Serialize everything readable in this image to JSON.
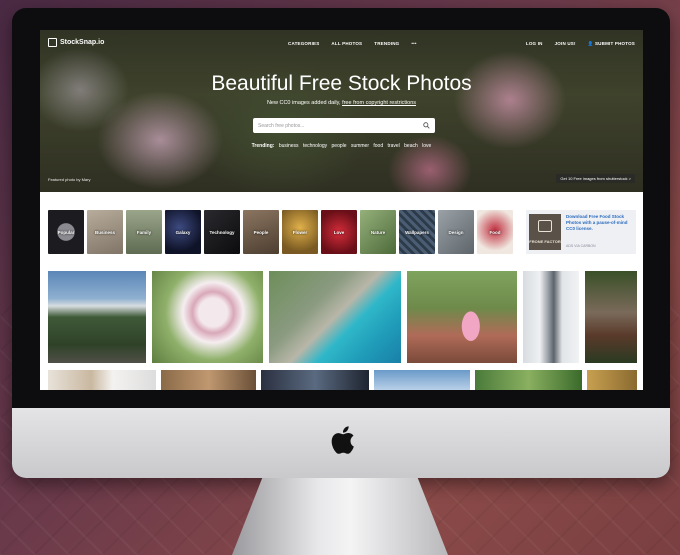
{
  "site": {
    "name": "StockSnap.io"
  },
  "nav": {
    "center": [
      "CATEGORIES",
      "ALL PHOTOS",
      "TRENDING",
      "•••"
    ],
    "right": [
      "LOG IN",
      "JOIN US!",
      "SUBMIT PHOTOS"
    ]
  },
  "hero": {
    "title": "Beautiful Free Stock Photos",
    "subtitle_prefix": "New CC0 images added daily,",
    "subtitle_link": "free from copyright restrictions",
    "search_placeholder": "Search free photos...",
    "trending_label": "Trending:",
    "trending_tags": [
      "business",
      "technology",
      "people",
      "summer",
      "food",
      "travel",
      "beach",
      "love"
    ],
    "photo_credit": "Featured photo by Mary",
    "promo_button": "Get 10 Free images from shutterstock >"
  },
  "categories": [
    {
      "label": "Popular",
      "color": "#2b2b30"
    },
    {
      "label": "Business",
      "color": "#9a8f80"
    },
    {
      "label": "Family",
      "color": "#7e8a74"
    },
    {
      "label": "Galaxy",
      "color": "#1c2240"
    },
    {
      "label": "Technology",
      "color": "#1a1a1c"
    },
    {
      "label": "People",
      "color": "#6b5a48"
    },
    {
      "label": "Flower",
      "color": "#b78b3a"
    },
    {
      "label": "Love",
      "color": "#a11d2a"
    },
    {
      "label": "Nature",
      "color": "#6f8a55"
    },
    {
      "label": "Wallpapers",
      "color": "#3b4d60"
    },
    {
      "label": "Design",
      "color": "#7a8288"
    },
    {
      "label": "Food",
      "color": "#8a2030"
    }
  ],
  "ad": {
    "logo_text": "FRONE FACTOR",
    "text": "Download Free Food Stock Photos with a pause-of-mind CC0 license.",
    "small": "ADS VIA CARBON"
  }
}
